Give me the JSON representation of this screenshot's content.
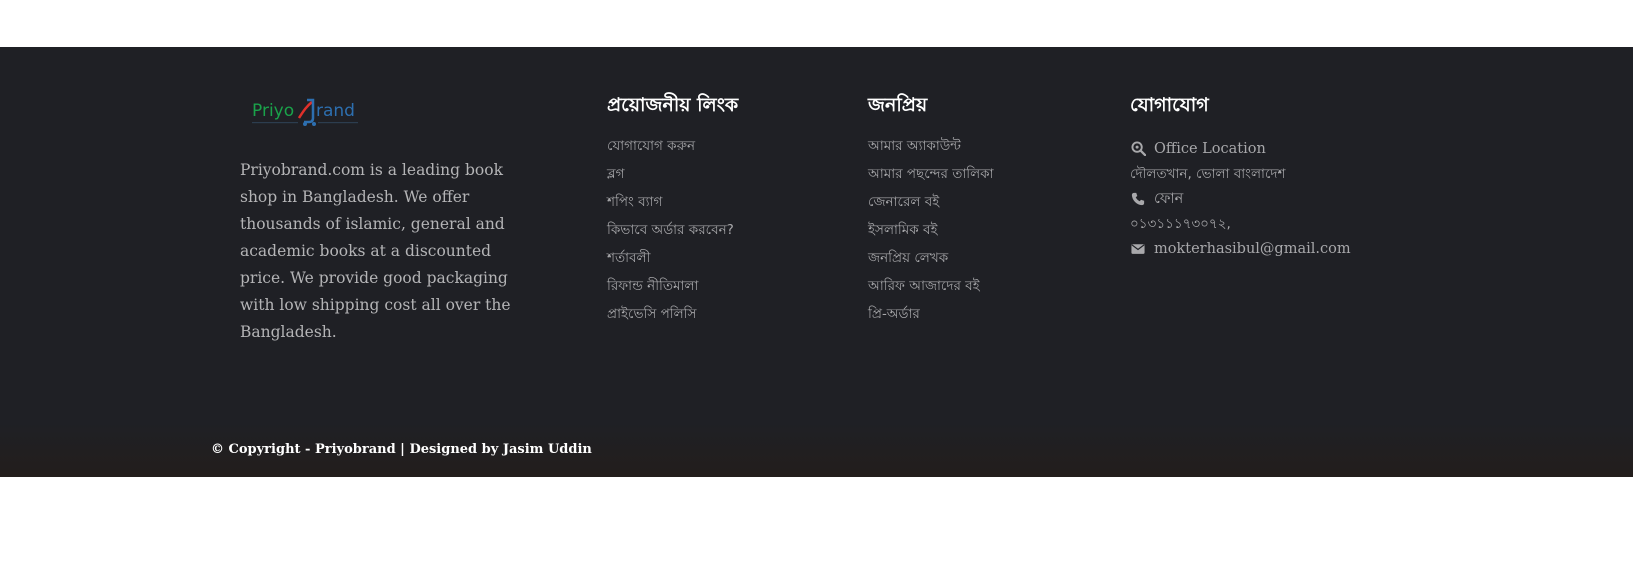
{
  "logo": {
    "text_part1": "Priyo",
    "text_part2": "rand",
    "brand_green": "#1aa24a",
    "brand_red": "#e0302a",
    "brand_blue": "#2d6fb0"
  },
  "about": {
    "text": "Priyobrand.com  is a leading book shop in Bangladesh. We offer thousands of islamic, general and academic books at a discounted price. We provide good packaging with low shipping cost all over the Bangladesh."
  },
  "links": {
    "heading": "প্রয়োজনীয় লিংক",
    "items": [
      {
        "label": "যোগাযোগ করুন"
      },
      {
        "label": "ব্লগ"
      },
      {
        "label": "শপিং ব্যাগ"
      },
      {
        "label": "কিভাবে অর্ডার করবেন?"
      },
      {
        "label": "শর্তাবলী"
      },
      {
        "label": "রিফান্ড নীতিমালা"
      },
      {
        "label": "প্রাইভেসি পলিসি"
      }
    ]
  },
  "popular": {
    "heading": "জনপ্রিয়",
    "items": [
      {
        "label": "আমার অ্যাকাউন্ট"
      },
      {
        "label": "আমার পছন্দের তালিকা"
      },
      {
        "label": "জেনারেল বই"
      },
      {
        "label": "ইসলামিক বই"
      },
      {
        "label": "জনপ্রিয় লেখক"
      },
      {
        "label": "আরিফ আজাদের বই"
      },
      {
        "label": "প্রি-অর্ডার"
      }
    ]
  },
  "contact": {
    "heading": "যোগাযোগ",
    "location_label": "Office Location",
    "location_icon": "search-location-icon",
    "address": "দৌলতখান, ভোলা বাংলাদেশ",
    "phone_label": "ফোন",
    "phone_icon": "phone-icon",
    "phone_number": "০১৩১১১৭৩০৭২,",
    "email": "mokterhasibul@gmail.com",
    "email_icon": "envelope-icon"
  },
  "copyright": {
    "text": "© Copyright - Priyobrand | Designed by Jasim Uddin"
  },
  "colors": {
    "footer_bg": "#1f2025",
    "bottom_bar_bg": "#231e1c",
    "text_muted": "#a8a8ab",
    "heading": "#ffffff"
  }
}
